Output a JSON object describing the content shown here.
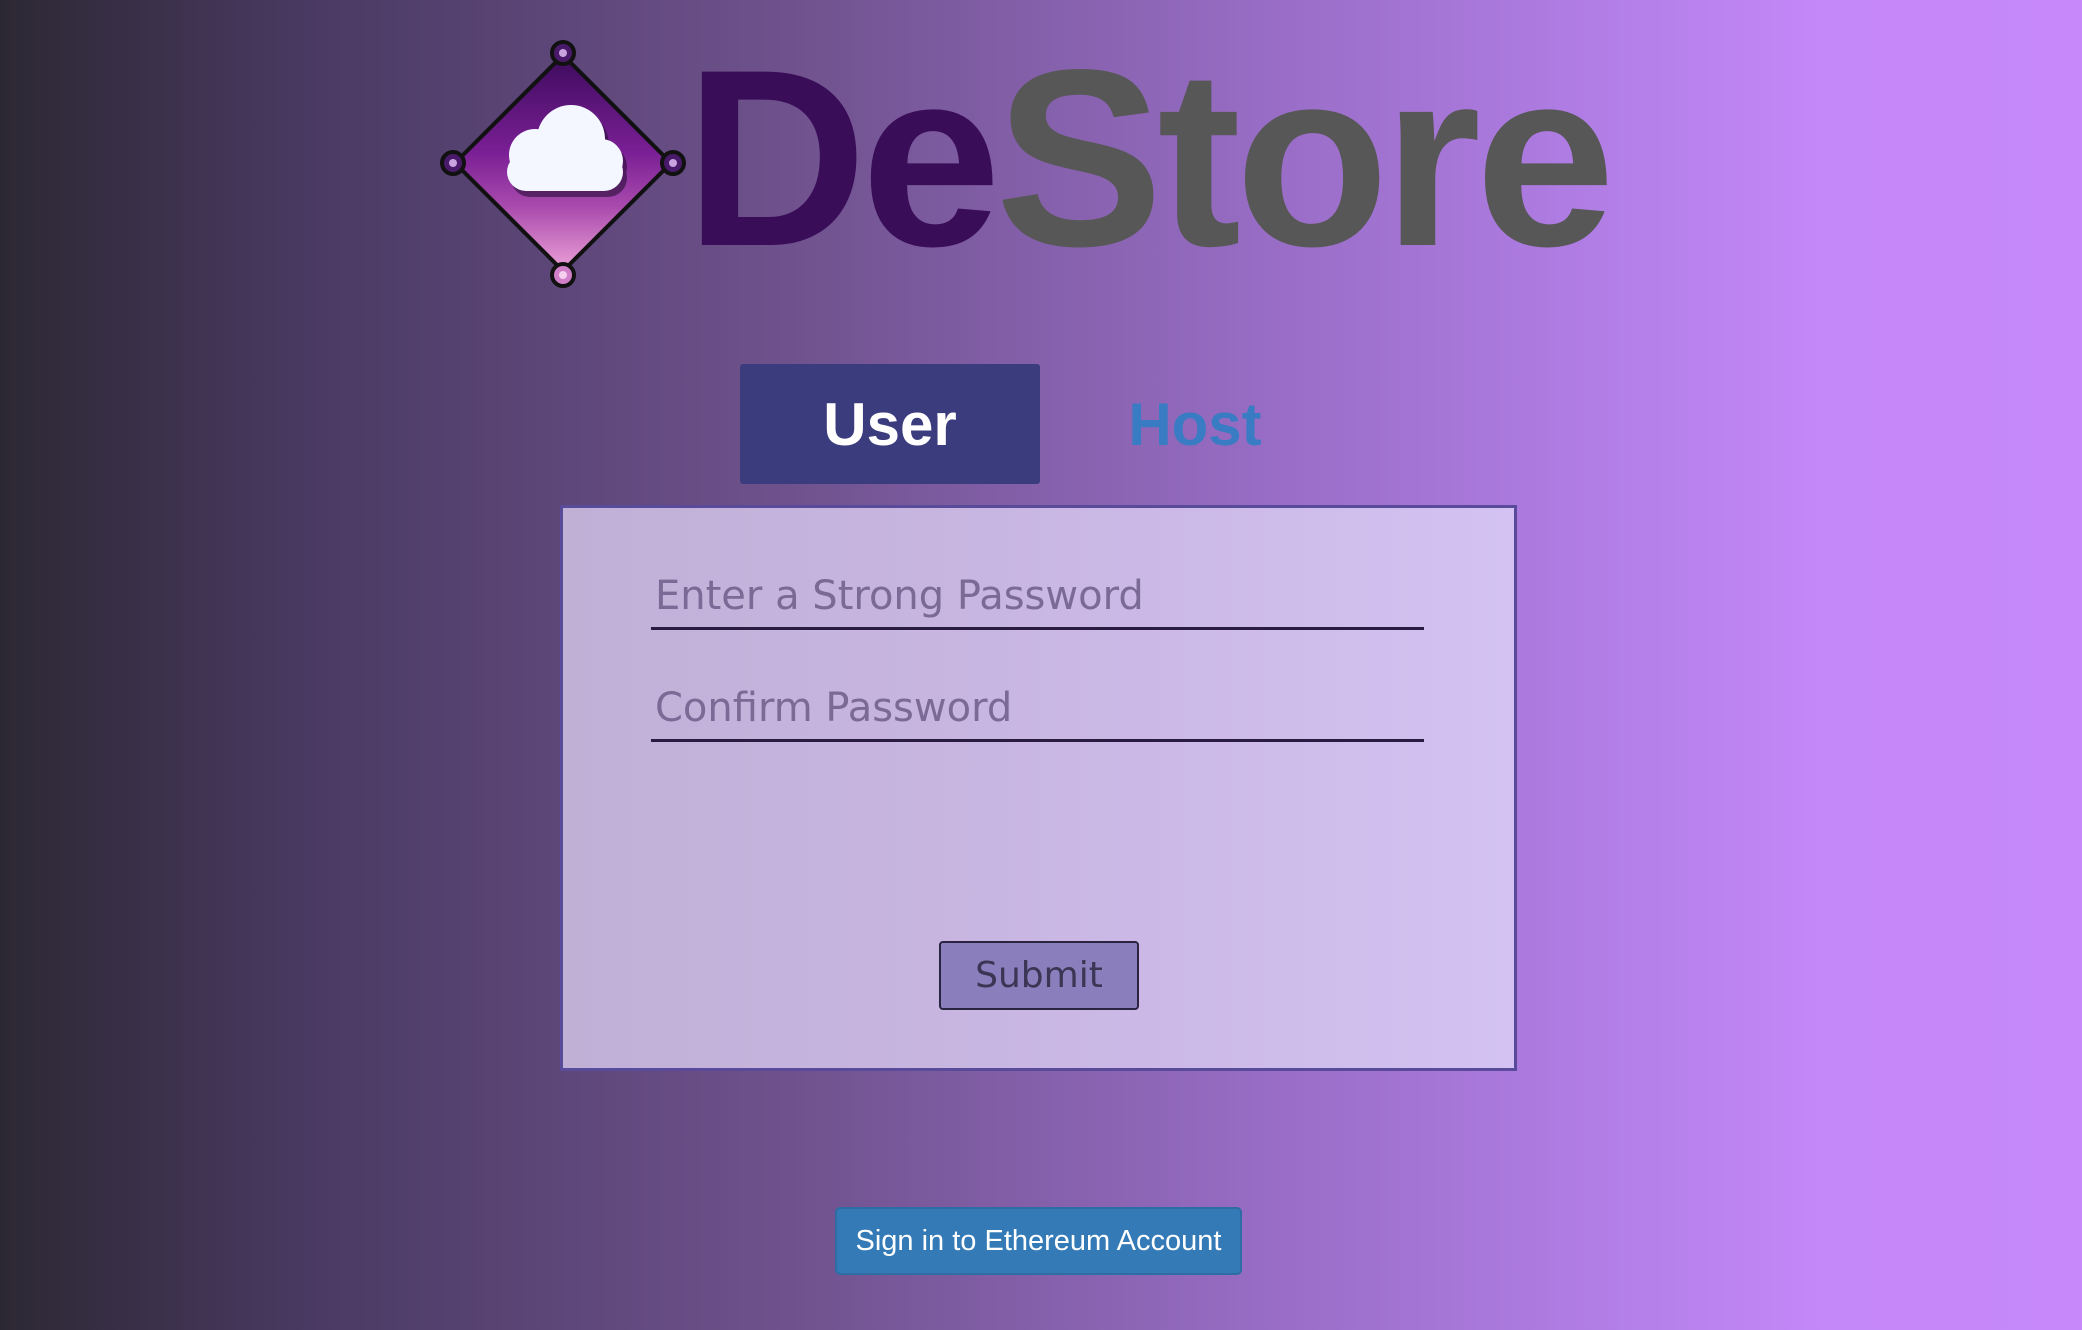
{
  "brand": {
    "name_part1": "De",
    "name_part2": "Store",
    "logo_icon": "cloud-diamond-icon",
    "colors": {
      "name_part1": "#3a0d58",
      "name_part2": "#575757",
      "icon_gradient_top": "#4a0e6e",
      "icon_gradient_bottom": "#e39ad6"
    }
  },
  "tabs": [
    {
      "label": "User",
      "active": true
    },
    {
      "label": "Host",
      "active": false
    }
  ],
  "form": {
    "password": {
      "placeholder": "Enter a Strong Password",
      "value": ""
    },
    "confirm": {
      "placeholder": "Confirm Password",
      "value": ""
    },
    "submit_label": "Submit"
  },
  "ethereum": {
    "sign_in_label": "Sign in to Ethereum Account"
  },
  "colors": {
    "active_tab_bg": "#3b3c7e",
    "inactive_tab_text": "#3a7cc3",
    "primary_button": "#337ab7"
  }
}
